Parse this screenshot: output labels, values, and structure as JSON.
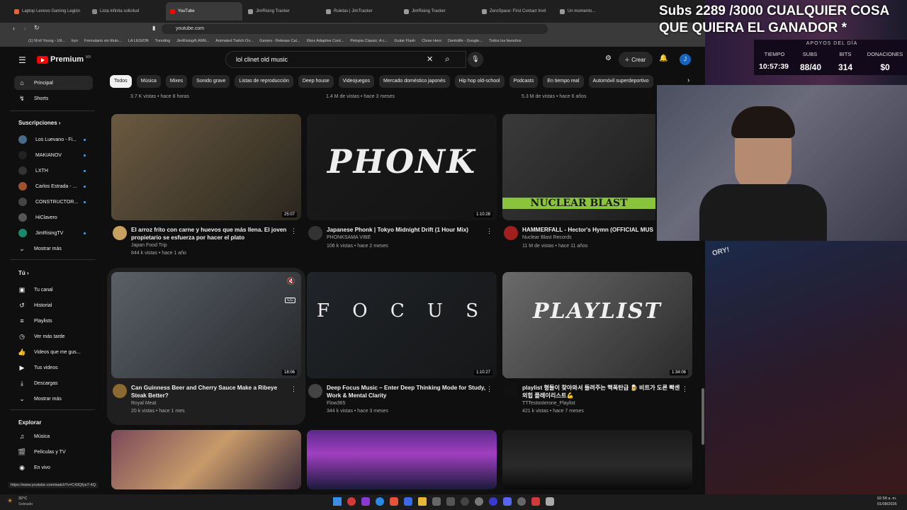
{
  "tabs": [
    {
      "label": "Laptop Lenovo Gaming Legión",
      "color": "#e8633a"
    },
    {
      "label": "Lista infinita solicitud",
      "color": "#888"
    },
    {
      "label": "YouTube",
      "color": "#ff0000",
      "active": true
    },
    {
      "label": "JimRising Tracker",
      "color": "#999"
    },
    {
      "label": "Ruletas | JimTracker",
      "color": "#999"
    },
    {
      "label": "JimRising Tracker",
      "color": "#999"
    },
    {
      "label": "ZeroSpace: First Contact Invit",
      "color": "#999"
    },
    {
      "label": "Un momento...",
      "color": "#999"
    }
  ],
  "url": "youtube.com",
  "bookmarks": [
    "(1) N'nil Young - Ult...",
    "tryn",
    "Formulario sin título...",
    "LA LEGION",
    "Trending",
    "JimRising#LANN...",
    "Animated Twitch Ov...",
    "Games - Release Cal...",
    "Xbox Adaptive Cont...",
    "Petopia Classic: A c...",
    "Guitar Flash",
    "Clone Hero",
    "Dentolife - Google...",
    "Todos los favoritos"
  ],
  "header": {
    "brand": "Premium",
    "region": "MX",
    "search_value": "lol clinet old music",
    "create_label": "Crear",
    "avatar_letter": "J"
  },
  "chips": [
    "Todos",
    "Música",
    "Mixes",
    "Sonido grave",
    "Listas de reproducción",
    "Deep house",
    "Videojuegos",
    "Mercado doméstico japonés",
    "Hip hop old-school",
    "Podcasts",
    "En tiempo real",
    "Automóvil superdeportivo"
  ],
  "sidebar": {
    "top": [
      "Principal",
      "Shorts"
    ],
    "subs_heading": "Suscripciones",
    "subs": [
      {
        "label": "Los Luevano - Fi...",
        "color": "#4a6a8a"
      },
      {
        "label": "MAKIANOV",
        "color": "#222"
      },
      {
        "label": "LXTH",
        "color": "#333"
      },
      {
        "label": "Carlos Estrada - ...",
        "color": "#a0522d"
      },
      {
        "label": "CONSTRUCTOR...",
        "color": "#444"
      },
      {
        "label": "HiClavero",
        "color": "#555"
      },
      {
        "label": "JimRisingTV",
        "color": "#1a8a6a"
      }
    ],
    "show_more": "Mostrar más",
    "you_heading": "Tú",
    "you": [
      "Tu canal",
      "Historial",
      "Playlists",
      "Ver más tarde",
      "Videos que me gus...",
      "Tus videos",
      "Descargas",
      "Mostrar más"
    ],
    "explore_heading": "Explorar",
    "explore": [
      "Música",
      "Películas y TV",
      "En vivo"
    ]
  },
  "prev_row": [
    "3.7 K vistas • hace 8 horas",
    "1.4 M de vistas • hace 3 meses",
    "5.3 M de vistas • hace 6 años"
  ],
  "videos": [
    {
      "title": "El arroz frito con carne y huevos que más llena. El joven propietario se esfuerza por hacer el plato",
      "channel": "Japan Food Trip",
      "meta": "844 k vistas • hace 1 año",
      "duration": "25:07",
      "thumb": "#6a5a40",
      "avatar": "#c8a060"
    },
    {
      "title": "Japanese Phonk | Tokyo Midnight Drift (1 Hour Mix)",
      "channel": "PHONKSAMA VIBE",
      "meta": "106 k vistas • hace 2 meses",
      "duration": "1:10:28",
      "thumb": "#1a1a1a",
      "avatar": "#333",
      "overlay_text": "PHONK"
    },
    {
      "title": "HAMMERFALL - Hector's Hymn (OFFICIAL MUS",
      "channel": "Nuclear Blast Records",
      "meta": "11 M de vistas • hace 11 años",
      "duration": "",
      "thumb": "#3a3a3a",
      "avatar": "#a02020",
      "overlay_text": "NUCLEAR BLAST"
    },
    {
      "title": "Can Guinness Beer and Cherry Sauce Make a Ribeye Steak Better?",
      "channel": "Royal Meat",
      "meta": "20 k vistas • hace 1 mes",
      "duration": "18:06",
      "thumb": "#5a6068",
      "avatar": "#8a6a30"
    },
    {
      "title": "Deep Focus Music – Enter Deep Thinking Mode for Study, Work & Mental Clarity",
      "channel": "Flow365",
      "meta": "344 k vistas • hace 3 meses",
      "duration": "1:10:27",
      "thumb": "#202428",
      "avatar": "#444",
      "overlay_text": "F O C U S"
    },
    {
      "title": "playlist 형들이 찾아와서 들려주는 핵폭탄급 🍺 비트가 도른 빡센 외힙 플레이리스트💪",
      "channel": "TTTestosterone_Playlist",
      "meta": "421 k vistas • hace 7 meses",
      "duration": "1:34:06",
      "thumb": "#6a6a6a",
      "avatar": "#111",
      "overlay_text": "PLAYLIST"
    }
  ],
  "overlay": {
    "subs_text": "Subs 2289 /3000 CUALQUIER COSA QUE QUIERA EL GANADOR *",
    "heading": "APOYOS DEL DÍA",
    "labels": [
      "TIEMPO",
      "SUBS",
      "BITS",
      "DONACIONES"
    ],
    "values": [
      "10:57:39",
      "88/40",
      "314",
      "$0"
    ]
  },
  "status_url": "https://www.youtube.com/watch?v=C43Qfye7-4Q",
  "taskbar": {
    "weather_temp": "32°C",
    "weather_desc": "Soleado",
    "time": "02:58 a. m.",
    "date": "01/08/2026"
  }
}
